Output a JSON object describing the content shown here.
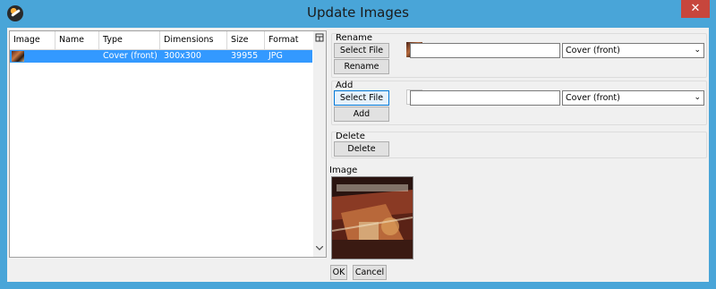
{
  "window": {
    "title": "Update Images",
    "close_glyph": "✕",
    "app_icon": "app-logo-icon"
  },
  "table": {
    "columns": [
      "Image",
      "Name",
      "Type",
      "Dimensions",
      "Size",
      "Format"
    ],
    "rows": [
      {
        "name": "",
        "type": "Cover (front)",
        "dimensions": "300x300",
        "size": "39955",
        "format": "JPG"
      }
    ]
  },
  "rename": {
    "title": "Rename",
    "select_file": "Select File",
    "path_value": "",
    "type_value": "Cover (front)",
    "action": "Rename"
  },
  "add": {
    "title": "Add",
    "select_file": "Select File",
    "path_value": "",
    "type_value": "Cover (front)",
    "action": "Add"
  },
  "delete": {
    "title": "Delete",
    "action": "Delete"
  },
  "image_preview": {
    "label": "Image"
  },
  "footer": {
    "ok": "OK",
    "cancel": "Cancel"
  }
}
